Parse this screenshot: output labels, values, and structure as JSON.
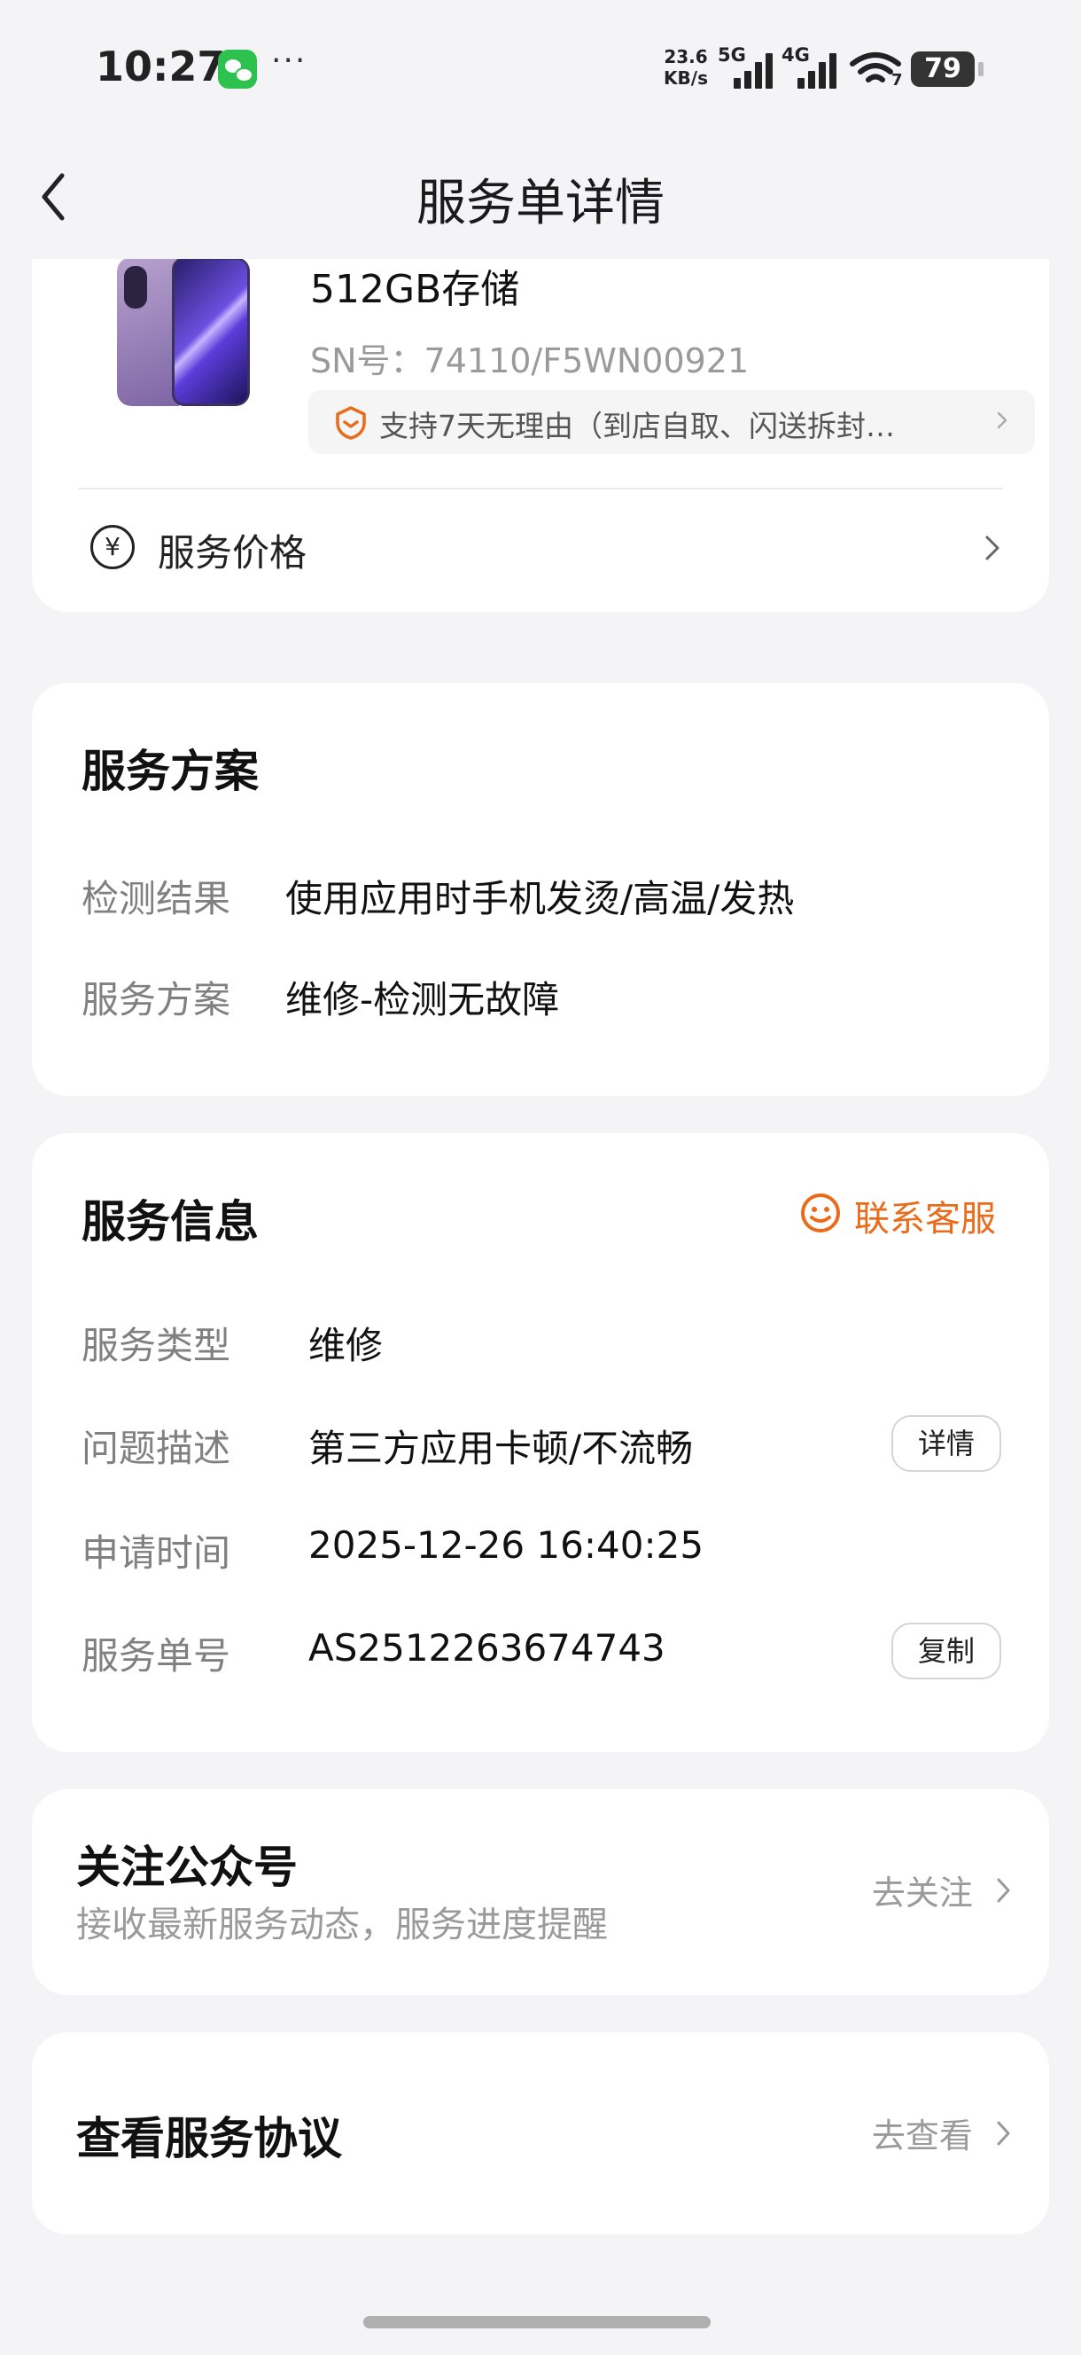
{
  "status_bar": {
    "time": "10:27",
    "more": "···",
    "net_speed": "23.6",
    "net_unit": "KB/s",
    "sig1_label": "5G",
    "sig2_label": "4G",
    "wifi_sub": "7",
    "battery": "79"
  },
  "nav": {
    "title": "服务单详情"
  },
  "product": {
    "name": "512GB存储",
    "sn": "SN号：74110/F5WN00921",
    "promo_text": "支持7天无理由（到店自取、闪送拆封…",
    "price_label": "服务价格",
    "yen_symbol": "¥"
  },
  "plan": {
    "title": "服务方案",
    "rows": [
      {
        "label": "检测结果",
        "value": "使用应用时手机发烫/高温/发热"
      },
      {
        "label": "服务方案",
        "value": "维修-检测无故障"
      }
    ]
  },
  "info": {
    "title": "服务信息",
    "contact_label": "联系客服",
    "rows": [
      {
        "label": "服务类型",
        "value": "维修"
      },
      {
        "label": "问题描述",
        "value": "第三方应用卡顿/不流畅",
        "button": "详情"
      },
      {
        "label": "申请时间",
        "value": "2025-12-26 16:40:25"
      },
      {
        "label": "服务单号",
        "value": "AS2512263674743",
        "button": "复制"
      }
    ]
  },
  "follow": {
    "title": "关注公众号",
    "subtitle": "接收最新服务动态，服务进度提醒",
    "link": "去关注"
  },
  "agreement": {
    "title": "查看服务协议",
    "link": "去查看"
  },
  "colors": {
    "accent": "#ea6b1a",
    "page_bg": "#f4f4f6",
    "card_bg": "#ffffff"
  }
}
